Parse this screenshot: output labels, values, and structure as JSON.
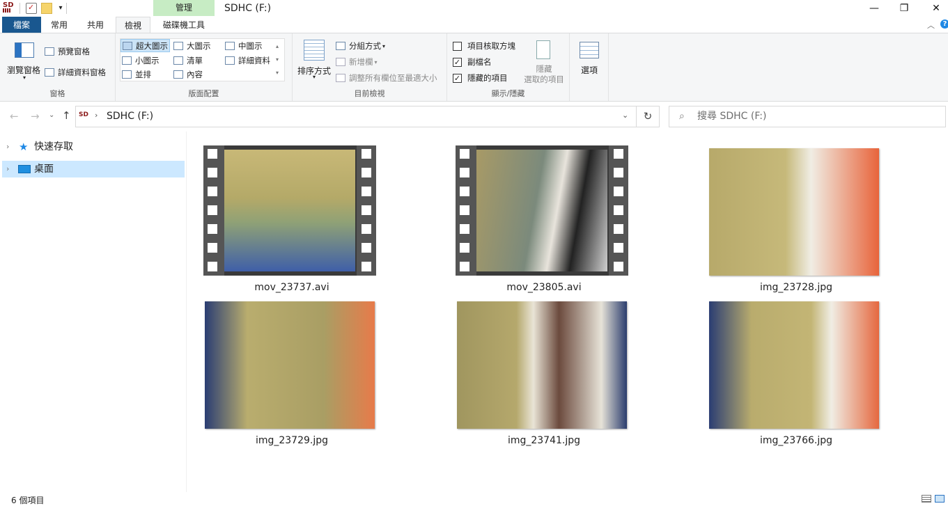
{
  "window": {
    "title": "SDHC (F:)",
    "manage_tab": "管理",
    "minimize": "—",
    "maximize": "❐",
    "close": "✕"
  },
  "quick_access": {
    "drive_logo": "SD"
  },
  "tabs": [
    {
      "label": "檔案"
    },
    {
      "label": "常用"
    },
    {
      "label": "共用"
    },
    {
      "label": "檢視"
    },
    {
      "label": "磁碟機工具"
    }
  ],
  "ribbon": {
    "panes": {
      "navigation_pane": "瀏覽窗格",
      "preview_pane": "預覽窗格",
      "details_pane": "詳細資料窗格",
      "label": "窗格"
    },
    "layout": {
      "items": [
        "超大圖示",
        "大圖示",
        "中圖示",
        "小圖示",
        "清單",
        "詳細資料",
        "並排",
        "內容"
      ],
      "label": "版面配置"
    },
    "current_view": {
      "sort_by": "排序方式",
      "group_by": "分組方式",
      "add_columns": "新增欄",
      "size_all_columns": "調整所有欄位至最適大小",
      "label": "目前檢視"
    },
    "show_hide": {
      "item_checkboxes": "項目核取方塊",
      "file_extensions": "副檔名",
      "hidden_items": "隱藏的項目",
      "hide_selected_1": "隱藏",
      "hide_selected_2": "選取的項目",
      "label": "顯示/隱藏",
      "item_checkboxes_checked": false,
      "file_extensions_checked": true,
      "hidden_items_checked": true
    },
    "options": "選項"
  },
  "address": {
    "path": "SDHC (F:)",
    "search_placeholder": "搜尋 SDHC (F:)"
  },
  "nav": [
    {
      "label": "快速存取"
    },
    {
      "label": "桌面"
    }
  ],
  "files": [
    {
      "name": "mov_23737.avi",
      "type": "video"
    },
    {
      "name": "mov_23805.avi",
      "type": "video"
    },
    {
      "name": "img_23728.jpg",
      "type": "image"
    },
    {
      "name": "img_23729.jpg",
      "type": "image"
    },
    {
      "name": "img_23741.jpg",
      "type": "image"
    },
    {
      "name": "img_23766.jpg",
      "type": "image"
    }
  ],
  "status": {
    "item_count": "6 個項目"
  },
  "colors": {
    "file_tab": "#19578f",
    "manage_tab": "#c7ecc4",
    "nav_selected": "#cce8ff",
    "accent_icon": "#1e88e5"
  }
}
